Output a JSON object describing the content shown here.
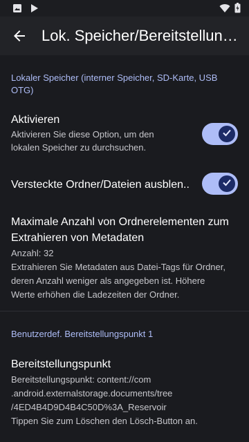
{
  "appbar": {
    "title": "Lok. Speicher/Bereitstellungspunkte"
  },
  "local_storage": {
    "category": "Lokaler Speicher (interner Speicher, SD-Karte, USB OTG)",
    "enable": {
      "title": "Aktivieren",
      "summary_line1": "Aktivieren Sie diese Option, um den",
      "summary_line2": "lokalen Speicher zu durchsuchen.",
      "checked": true
    },
    "hidden": {
      "title": "Versteckte Ordner/Dateien ausblen..",
      "checked": true
    },
    "max_items": {
      "title_line1": "Maximale Anzahl von Ordnerelementen zum",
      "title_line2": "Extrahieren von Metadaten",
      "count": "Anzahl: 32",
      "desc_line1": "Extrahieren Sie Metadaten aus Datei-Tags für Ordner,",
      "desc_line2": "deren Anzahl weniger als angegeben ist. Höhere",
      "desc_line3": "Werte erhöhen die Ladezeiten der Ordner."
    }
  },
  "custom_mount": {
    "category": "Benutzerdef. Bereitstellungspunkt 1",
    "mount": {
      "title": "Bereitstellungspunkt",
      "line1": "Bereitstellungspunkt: content://com",
      "line2": ".android.externalstorage.documents/tree",
      "line3": "/4ED4B4D9D4B4C50D%3A_Reservoir",
      "line4": "Tippen Sie zum Löschen den Lösch-Button an."
    }
  },
  "colors": {
    "accent": "#aebdf7",
    "background": "#1a1b1f",
    "thumb": "#1c2b66"
  }
}
